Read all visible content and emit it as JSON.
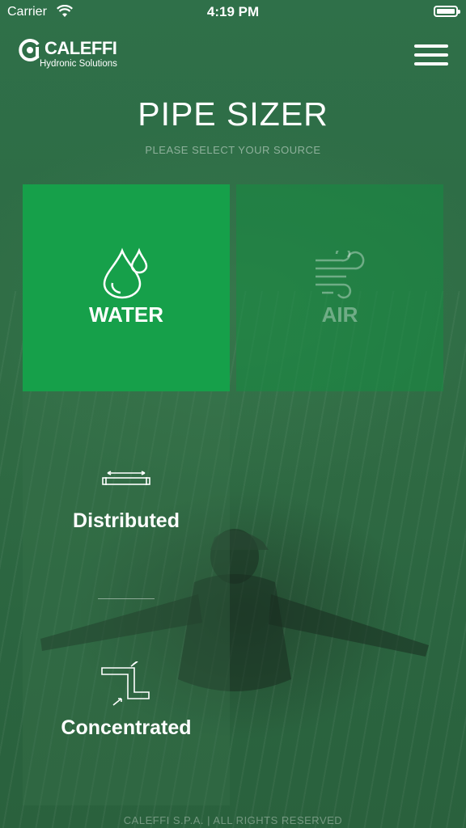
{
  "status_bar": {
    "carrier": "Carrier",
    "time": "4:19 PM",
    "battery_level": 1.0
  },
  "header": {
    "brand": "CALEFFI",
    "tagline": "Hydronic Solutions"
  },
  "page": {
    "title": "PIPE SIZER",
    "subtitle": "PLEASE SELECT YOUR SOURCE"
  },
  "sources": [
    {
      "label": "WATER",
      "icon": "water-drops-icon",
      "selected": true
    },
    {
      "label": "AIR",
      "icon": "wind-icon",
      "selected": false
    }
  ],
  "water_options": [
    {
      "label": "Distributed",
      "icon": "distributed-pipe-icon"
    },
    {
      "label": "Concentrated",
      "icon": "concentrated-pipe-icon"
    }
  ],
  "footer": "CALEFFI S.P.A. | ALL RIGHTS RESERVED",
  "colors": {
    "accent": "#16a04a",
    "background": "#2d6a44"
  }
}
